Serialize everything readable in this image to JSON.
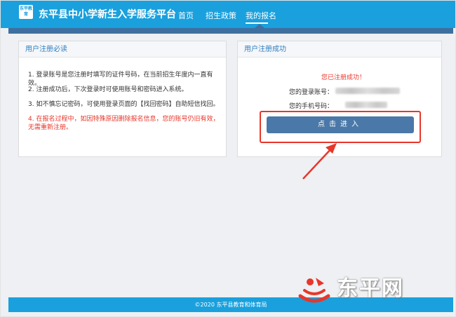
{
  "header": {
    "logo_text": "东平教育",
    "site_title": "东平县中小学新生入学服务平台",
    "nav": [
      {
        "label": "首页"
      },
      {
        "label": "招生政策"
      },
      {
        "label": "我的报名"
      }
    ]
  },
  "left_panel": {
    "title": "用户注册必读",
    "notices": [
      "1. 登录账号是您注册时填写的证件号码，在当前招生年度内一直有效。",
      "2. 注册成功后，下次登录时可使用账号和密码进入系统。",
      "3. 如不慎忘记密码，可使用登录页面的【找回密码】自助短信找回。",
      "4. 在报名过程中，如因特殊原因删除报名信息，您的账号仍旧有效，无需重新注册。"
    ]
  },
  "right_panel": {
    "title": "用户注册成功",
    "success_message": "您已注册成功！",
    "account_label": "您的登录账号：",
    "phone_label": "您的手机号码：",
    "enter_button": "点击进入"
  },
  "footer": {
    "text": "©2020  东平县教育和体育局"
  },
  "watermark": {
    "text": "东平网"
  },
  "colors": {
    "brand_blue": "#1aa0dd",
    "dark_blue": "#3f6fa0",
    "button_blue": "#4a78a8",
    "alert_red": "#e8362a"
  }
}
